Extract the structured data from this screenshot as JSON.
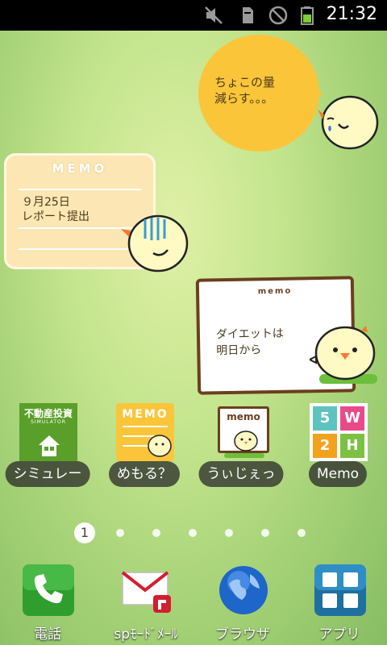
{
  "status_bar": {
    "time": "21:32",
    "icons": [
      "mute-icon",
      "sd-card-icon",
      "no-signal-icon",
      "battery-icon"
    ]
  },
  "widgets": {
    "bubble": {
      "text": "ちょこの量\n減らす。。。"
    },
    "memo_card": {
      "title": "MEMO",
      "text": "９月25日\nレポート提出"
    },
    "paper_memo": {
      "title": "memo",
      "text": "ダイエットは\n明日から"
    }
  },
  "apps": [
    {
      "label": "シミュレー",
      "icon": "real-estate-simulator-icon",
      "icon_text": "不動産投資",
      "icon_subtext": "SIMULATOR"
    },
    {
      "label": "めもる？",
      "icon": "memo-chick-icon",
      "icon_text": "MEMO"
    },
    {
      "label": "うぃじぇっ",
      "icon": "memo-widget-icon",
      "icon_text": "memo"
    },
    {
      "label": "Memo",
      "icon": "5w2h-memo-icon",
      "icon_letters": [
        "5",
        "W",
        "2",
        "H"
      ]
    }
  ],
  "page_indicator": {
    "current": "1"
  },
  "dock": [
    {
      "label": "電話",
      "icon": "phone-icon"
    },
    {
      "label": "spﾓｰﾄﾞﾒｰﾙ",
      "icon": "mail-icon"
    },
    {
      "label": "ブラウザ",
      "icon": "globe-icon"
    },
    {
      "label": "アプリ",
      "icon": "app-drawer-icon"
    }
  ],
  "colors": {
    "wallpaper": "#c4e58e",
    "bubble": "#fbc53a",
    "memo_card": "#fce6b3",
    "paper_border": "#6b3f1e"
  }
}
